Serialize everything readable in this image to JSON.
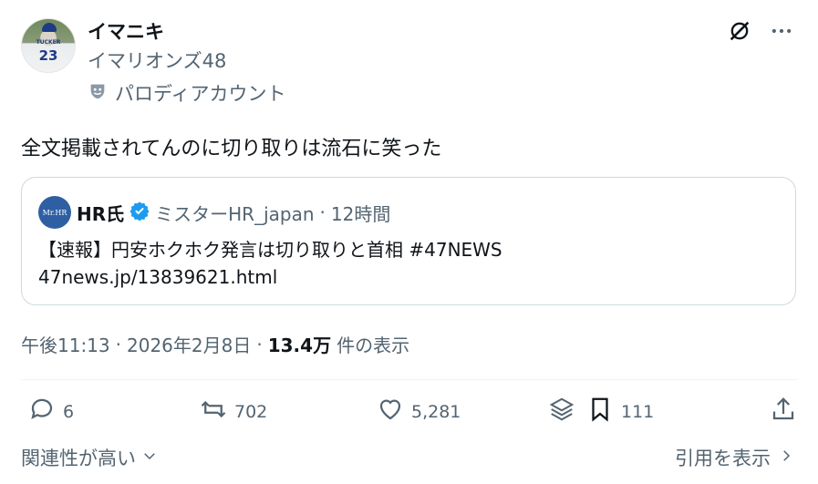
{
  "author": {
    "display_name": "イマニキ",
    "handle": "イマリオンズ48",
    "parody_label": "パロディアカウント",
    "avatar_jersey_name": "TUCKER",
    "avatar_jersey_number": "23"
  },
  "tweet": {
    "text": "全文掲載されてんのに切り取りは流石に笑った"
  },
  "quoted": {
    "avatar_text": "Mr.HR",
    "name": "HR氏",
    "handle": "ミスターHR_japan",
    "separator": "·",
    "time": "12時間",
    "line1": "【速報】円安ホクホク発言は切り取りと首相  #47NEWS",
    "line2": "47news.jp/13839621.html"
  },
  "meta": {
    "time": "午後11:13",
    "sep1": "·",
    "date": "2026年2月8日",
    "sep2": "·",
    "views": "13.4万",
    "views_label": "件の表示"
  },
  "actions": {
    "replies": "6",
    "reposts": "702",
    "likes": "5,281",
    "bookmarks": "111"
  },
  "footer": {
    "sort_label": "関連性が高い",
    "quotes_label": "引用を表示"
  },
  "colors": {
    "text": "#0f1419",
    "secondary": "#536471",
    "verified": "#1d9bf0",
    "border": "#cfd9de"
  }
}
